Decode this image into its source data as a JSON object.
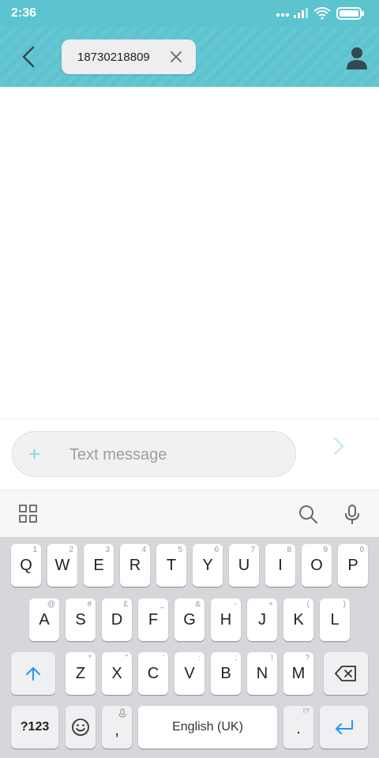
{
  "status_bar": {
    "time": "2:36"
  },
  "recipient": {
    "number": "18730218809"
  },
  "compose": {
    "placeholder": "Text message"
  },
  "keyboard": {
    "row1": [
      {
        "label": "Q",
        "hint": "1"
      },
      {
        "label": "W",
        "hint": "2"
      },
      {
        "label": "E",
        "hint": "3"
      },
      {
        "label": "R",
        "hint": "4"
      },
      {
        "label": "T",
        "hint": "5"
      },
      {
        "label": "Y",
        "hint": "6"
      },
      {
        "label": "U",
        "hint": "7"
      },
      {
        "label": "I",
        "hint": "8"
      },
      {
        "label": "O",
        "hint": "9"
      },
      {
        "label": "P",
        "hint": "0"
      }
    ],
    "row2": [
      {
        "label": "A",
        "hint": "@"
      },
      {
        "label": "S",
        "hint": "#"
      },
      {
        "label": "D",
        "hint": "£"
      },
      {
        "label": "F",
        "hint": "_"
      },
      {
        "label": "G",
        "hint": "&"
      },
      {
        "label": "H",
        "hint": "-"
      },
      {
        "label": "J",
        "hint": "+"
      },
      {
        "label": "K",
        "hint": "("
      },
      {
        "label": "L",
        "hint": ")"
      }
    ],
    "row3": [
      {
        "label": "Z",
        "hint": "*"
      },
      {
        "label": "X",
        "hint": "\""
      },
      {
        "label": "C",
        "hint": "'"
      },
      {
        "label": "V",
        "hint": ":"
      },
      {
        "label": "B",
        "hint": ";"
      },
      {
        "label": "N",
        "hint": "!"
      },
      {
        "label": "M",
        "hint": "?"
      }
    ],
    "symbols_label": "?123",
    "comma_label": ",",
    "space_label": "English (UK)",
    "period_label": ".",
    "period_hint": "!?"
  },
  "colors": {
    "accent": "#5cc3cf",
    "keyboard_bg": "#d6d7db",
    "enter_blue": "#2196f3"
  },
  "icons": {
    "status": [
      "signal-dots-icon",
      "cell-signal-icon",
      "wifi-icon",
      "battery-icon"
    ],
    "header": [
      "back-arrow-icon",
      "close-icon",
      "contact-person-icon"
    ],
    "compose": [
      "plus-icon",
      "send-arrow-icon"
    ],
    "toolbar": [
      "grid-menu-icon",
      "search-icon",
      "microphone-icon"
    ],
    "keyboard": [
      "shift-arrow-icon",
      "backspace-icon",
      "emoji-icon",
      "enter-icon"
    ]
  }
}
